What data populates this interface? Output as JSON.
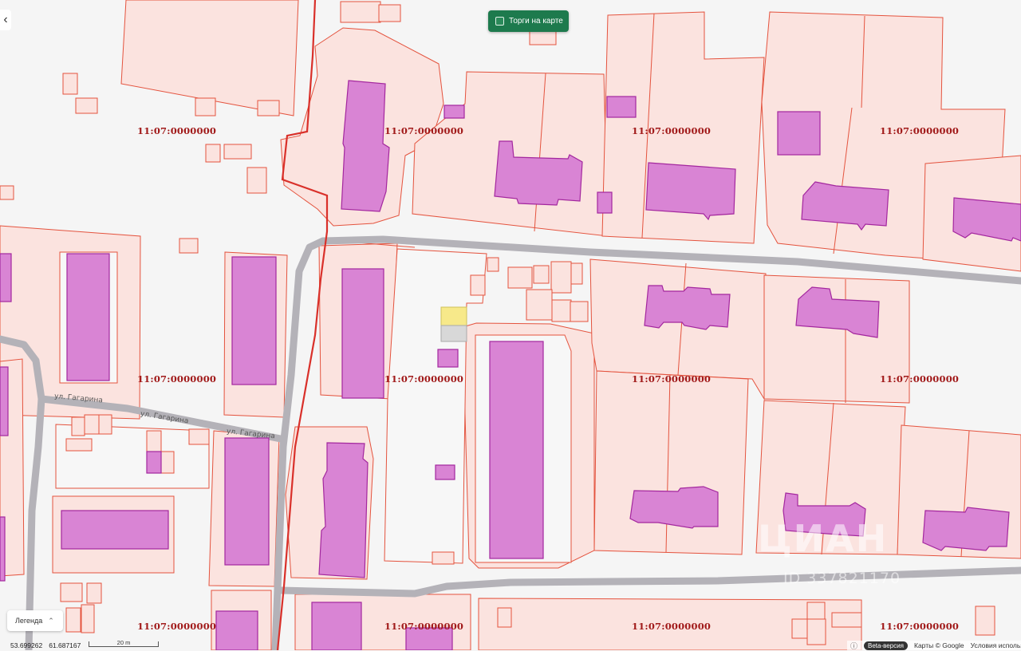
{
  "map": {
    "cadastral_numbers": [
      "11:07:0000000",
      "11:07:0000000",
      "11:07:0000000",
      "11:07:0000000",
      "11:07:0000000",
      "11:07:0000000",
      "11:07:0000000",
      "11:07:0000000",
      "11:07:0000000",
      "11:07:0000000",
      "11:07:0000000",
      "11:07:0000000"
    ],
    "street_labels": [
      "ул. Гагарина",
      "ул. Гагарина",
      "ул. Гагарина"
    ],
    "watermark": "ЦИАН",
    "watermark_id": "ID 337821170"
  },
  "controls": {
    "back_icon": "chevron-left-icon",
    "back_glyph": "‹",
    "auction_toggle_label": "Торги на карте",
    "legend_label": "Легенда",
    "legend_icon": "chevron-up-icon",
    "legend_glyph": "⌃"
  },
  "footer": {
    "latitude": "53.699262",
    "longitude": "61.687167",
    "scale_label": "20 m",
    "info_glyph": "ⓘ",
    "beta_badge": "Beta-версия",
    "map_attribution": "Карты © Google",
    "terms_link": "Условия использования"
  },
  "colors": {
    "parcel_fill": "#fbe3df",
    "parcel_stroke": "#e4533e",
    "building_fill": "#d984d4",
    "road": "#b4b2b8",
    "toggle_bg": "#1d7a4d"
  }
}
